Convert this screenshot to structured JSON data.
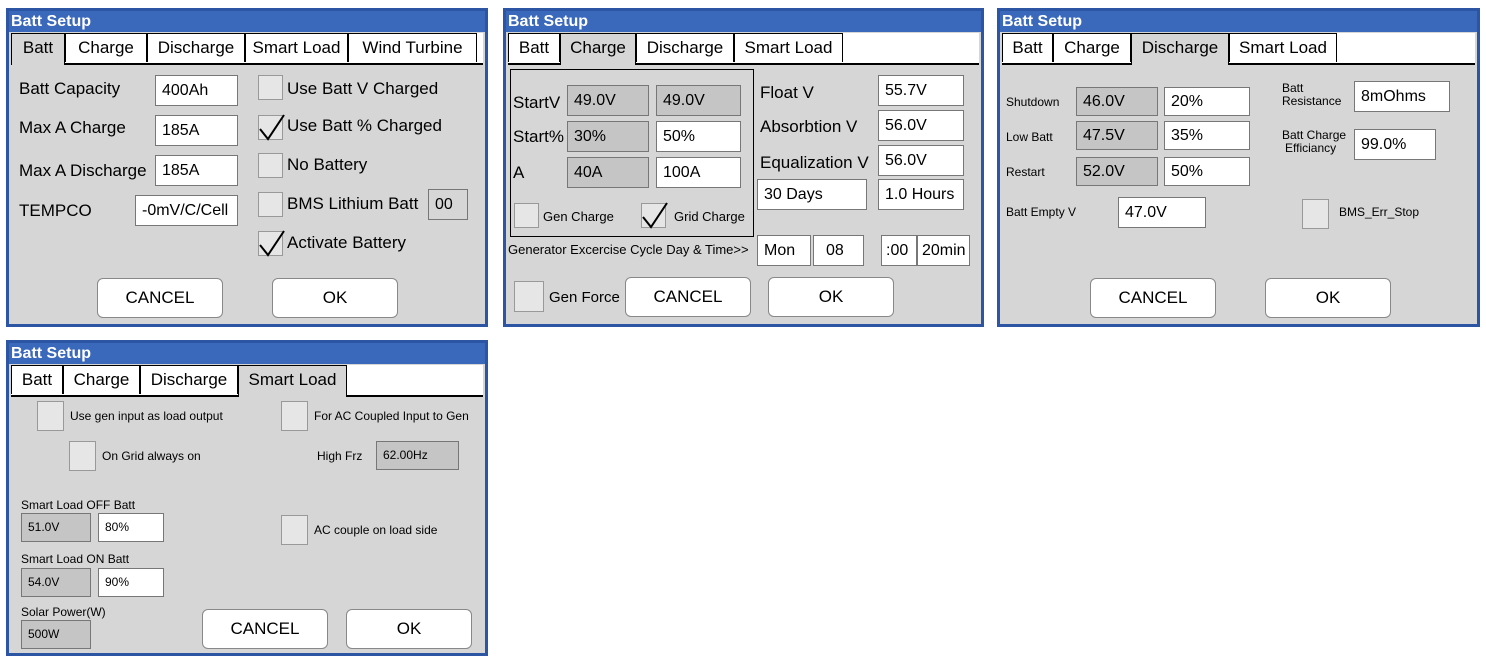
{
  "title": "Batt Setup",
  "tabs": {
    "batt": "Batt",
    "charge": "Charge",
    "discharge": "Discharge",
    "smart_load": "Smart Load",
    "wind_turbine": "Wind Turbine"
  },
  "buttons": {
    "cancel": "CANCEL",
    "ok": "OK"
  },
  "panel_batt": {
    "batt_capacity_label": "Batt Capacity",
    "batt_capacity": "400Ah",
    "max_a_charge_label": "Max A Charge",
    "max_a_charge": "185A",
    "max_a_discharge_label": "Max A Discharge",
    "max_a_discharge": "185A",
    "tempco_label": "TEMPCO",
    "tempco": "-0mV/C/Cell",
    "use_batt_v_charged": "Use Batt V Charged",
    "use_batt_pct_charged": "Use Batt % Charged",
    "no_battery": "No Battery",
    "bms_lithium_batt": "BMS Lithium Batt",
    "bms_code": "00",
    "activate_battery": "Activate Battery"
  },
  "panel_charge": {
    "startv_label": "StartV",
    "startv_1": "49.0V",
    "startv_2": "49.0V",
    "startpct_label": "Start%",
    "startpct_1": "30%",
    "startpct_2": "50%",
    "a_label": "A",
    "a_1": "40A",
    "a_2": "100A",
    "gen_charge": "Gen Charge",
    "grid_charge": "Grid Charge",
    "float_v_label": "Float V",
    "float_v": "55.7V",
    "absorbtion_v_label": "Absorbtion V",
    "absorbtion_v": "56.0V",
    "equalization_v_label": "Equalization V",
    "equalization_v": "56.0V",
    "days": "30 Days",
    "hours": "1.0 Hours",
    "gen_cycle_label": "Generator Excercise Cycle Day & Time>>",
    "gen_day": "Mon",
    "gen_hour": "08",
    "gen_min": ":00",
    "gen_dur": "20min",
    "gen_force": "Gen Force"
  },
  "panel_discharge": {
    "shutdown_label": "Shutdown",
    "shutdown_v": "46.0V",
    "shutdown_pct": "20%",
    "low_batt_label": "Low Batt",
    "low_batt_v": "47.5V",
    "low_batt_pct": "35%",
    "restart_label": "Restart",
    "restart_v": "52.0V",
    "restart_pct": "50%",
    "batt_resistance_label_1": "Batt",
    "batt_resistance_label_2": "Resistance",
    "batt_resistance": "8mOhms",
    "batt_charge_eff_label_1": "Batt Charge",
    "batt_charge_eff_label_2": "Efficiancy",
    "batt_charge_eff": "99.0%",
    "batt_empty_v_label": "Batt Empty V",
    "batt_empty_v": "47.0V",
    "bms_err_stop": "BMS_Err_Stop"
  },
  "panel_smart": {
    "use_gen_input": "Use gen input as load output",
    "ac_coupled_input": "For AC Coupled Input to Gen",
    "on_grid_always_on": "On Grid always on",
    "high_frz_label": "High Frz",
    "high_frz": "62.00Hz",
    "smart_off_label": "Smart Load OFF Batt",
    "smart_off_v": "51.0V",
    "smart_off_pct": "80%",
    "ac_couple_load_side": "AC couple on load side",
    "smart_on_label": "Smart Load ON Batt",
    "smart_on_v": "54.0V",
    "smart_on_pct": "90%",
    "solar_power_label": "Solar Power(W)",
    "solar_power": "500W"
  }
}
